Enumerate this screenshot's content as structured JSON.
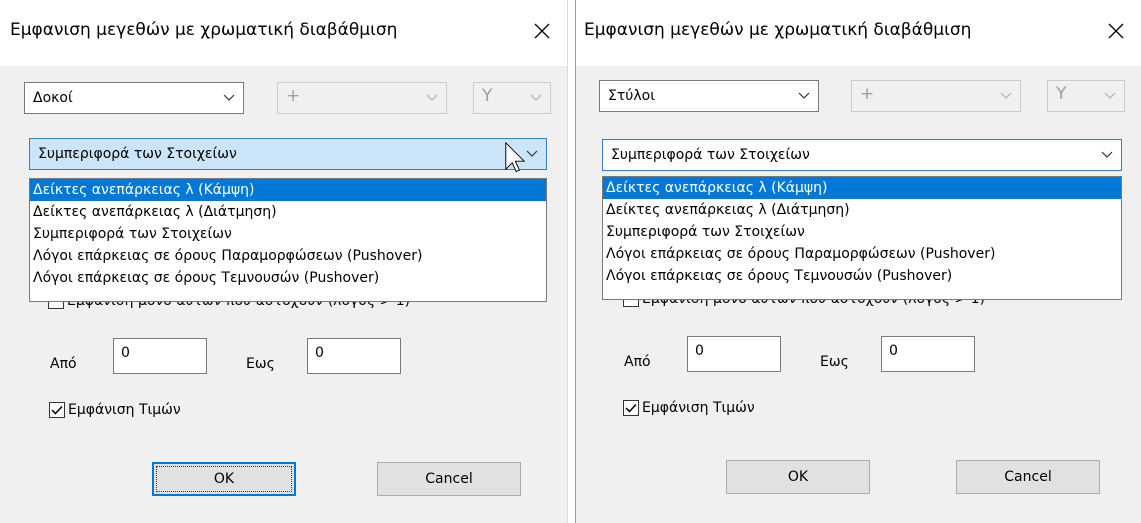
{
  "dialogs": [
    {
      "title": "Εμφανιση μεγεθών με χρωματική διαβάθμιση",
      "element_type": "Δοκοί",
      "operator": "+",
      "axis": "Y",
      "category": "Συμπεριφορά των Στοιχείων",
      "options": [
        "Δείκτες ανεπάρκειας λ (Κάμψη)",
        "Δείκτες ανεπάρκειας λ (Διάτμηση)",
        "Συμπεριφορά των Στοιχείων",
        "Λόγοι επάρκειας σε όρους Παραμορφώσεων (Pushover)",
        "Λόγοι επάρκειας σε όρους Τεμνουσών (Pushover)"
      ],
      "selected_option_index": 0,
      "partial_checkbox_label": "Εμφάνιση μόνο αυτών που αστοχούν (λόγος > 1)",
      "from_label": "Από",
      "from_value": "0",
      "to_label": "Εως",
      "to_value": "0",
      "show_values_label": "Εμφάνιση Τιμών",
      "show_values_checked": true,
      "ok_label": "OK",
      "cancel_label": "Cancel"
    },
    {
      "title": "Εμφανιση μεγεθών με χρωματική διαβάθμιση",
      "element_type": "Στύλοι",
      "operator": "+",
      "axis": "Y",
      "category": "Συμπεριφορά των Στοιχείων",
      "options": [
        "Δείκτες ανεπάρκειας λ (Κάμψη)",
        "Δείκτες ανεπάρκειας λ (Διάτμηση)",
        "Συμπεριφορά των Στοιχείων",
        "Λόγοι επάρκειας σε όρους Παραμορφώσεων (Pushover)",
        "Λόγοι επάρκειας σε όρους Τεμνουσών (Pushover)"
      ],
      "selected_option_index": 0,
      "partial_checkbox_label": "Εμφάνιση μόνο αυτών που αστοχούν (λόγος > 1)",
      "from_label": "Από",
      "from_value": "0",
      "to_label": "Εως",
      "to_value": "0",
      "show_values_label": "Εμφάνιση Τιμών",
      "show_values_checked": true,
      "ok_label": "OK",
      "cancel_label": "Cancel"
    }
  ],
  "icons": {
    "close": "close-icon",
    "dropdown": "chevron-down-icon",
    "checkbox": "checkmark-icon",
    "cursor": "mouse-pointer-icon"
  },
  "colors": {
    "selection": "#0078d7",
    "focus_border": "#2f7fd1",
    "focus_fill": "#cce4f7",
    "dialog_bg": "#f0f0f0"
  }
}
